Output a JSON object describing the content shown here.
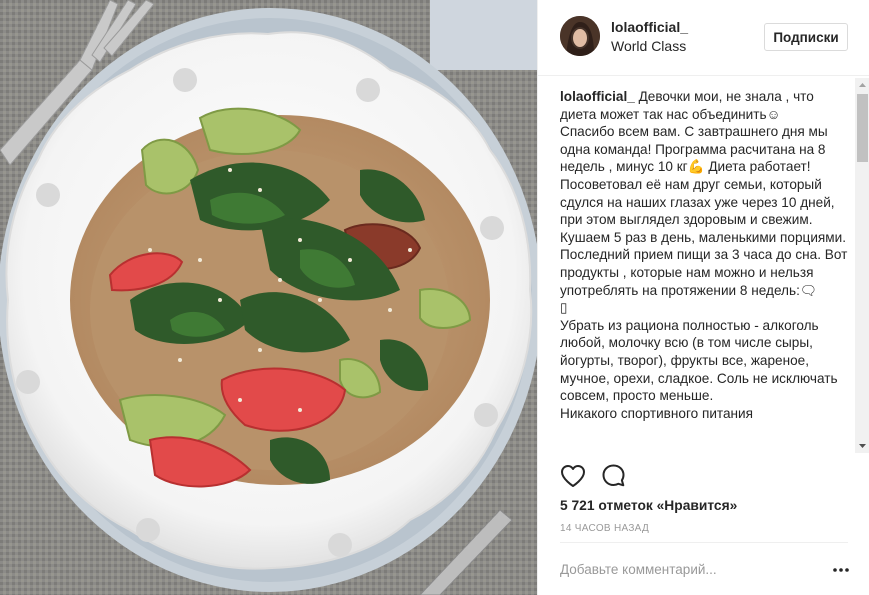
{
  "post": {
    "username": "lolaofficial_",
    "location": "World Class",
    "follow_label": "Подписки",
    "caption_user": "lolaofficial_",
    "caption_text": " Девочки мои, не знала , что диета может так нас объединить☺\nСпасибо всем вам. С завтрашнего дня мы одна команда! Программа расчитана на 8 недель , минус 10 кг💪 Диета работает! Посоветовал её нам друг семьи, который сдулся на наших глазах уже через 10 дней, при этом выглядел здоровым и свежим. Кушаем 5 раз в день, маленькими порциями. Последний прием пищи за 3 часа до сна. Вот продукты , которые нам можно и нельзя употреблять на протяжении 8 недель:🗨\n▯\nУбрать из рациона полностью - алкоголь любой, молочку всю (в том числе сыры, йогурты, творог), фрукты все, жареное, мучное, орехи, сладкое. Соль не исключать совсем, просто меньше.\nНикакого спортивного питания",
    "likes": "5 721 отметок «Нравится»",
    "timestamp": "14 ЧАСОВ НАЗАД",
    "comment_placeholder": "Добавьте комментарий...",
    "more_label": "•••"
  },
  "icons": {
    "like": "heart-outline-icon",
    "comment": "speech-bubble-icon",
    "more": "ellipsis-icon"
  },
  "colors": {
    "text": "#262626",
    "muted": "#999999",
    "border": "#efefef"
  }
}
